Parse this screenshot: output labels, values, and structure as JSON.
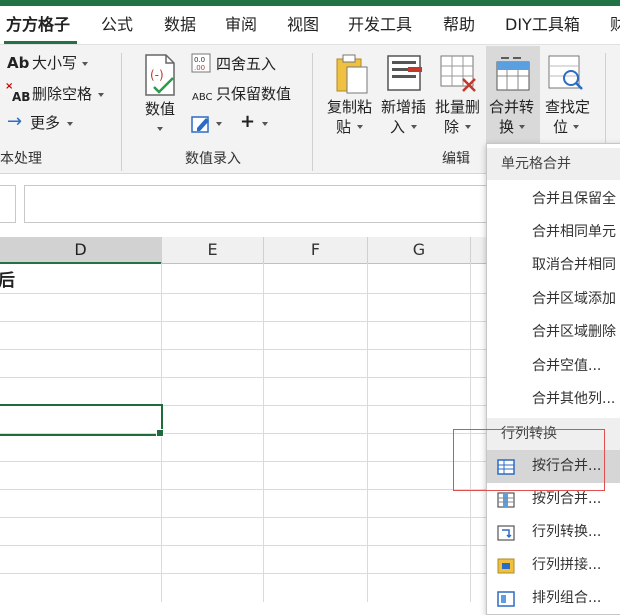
{
  "tabs": [
    "方方格子",
    "公式",
    "数据",
    "审阅",
    "视图",
    "开发工具",
    "帮助",
    "DIY工具箱",
    "财"
  ],
  "ribbon": {
    "text_group": {
      "case_label": "大小写",
      "case_icon_text": "Ab",
      "remove_space_label": "删除空格",
      "remove_space_icon_text": "AB",
      "more_label": "更多",
      "group_label": "本处理"
    },
    "number_group": {
      "value_label": "数值",
      "round_label": "四舍五入",
      "keep_number_label": "只保留数值",
      "keep_number_icon_text": "ABC",
      "group_label": "数值录入"
    },
    "edit_group": {
      "copy_paste_line1": "复制粘",
      "copy_paste_line2": "贴",
      "insert_line1": "新增插",
      "insert_line2": "入",
      "batch_delete_line1": "批量删",
      "batch_delete_line2": "除",
      "merge_convert_line1": "合并转",
      "merge_convert_line2": "换",
      "find_locate_line1": "查找定",
      "find_locate_line2": "位",
      "group_label": "编辑"
    }
  },
  "sheet": {
    "columns": [
      "D",
      "E",
      "F",
      "G"
    ],
    "cell_text": "后"
  },
  "dropdown": {
    "section1_title": "单元格合并",
    "section1_items": [
      "合并且保留全",
      "合并相同单元",
      "取消合并相同",
      "合并区域添加",
      "合并区域删除",
      "合并空值...",
      "合并其他列..."
    ],
    "section2_title": "行列转换",
    "section2_items": [
      "按行合并...",
      "按列合并...",
      "行列转换...",
      "行列拼接...",
      "排列组合..."
    ]
  },
  "colors": {
    "accent": "#217346",
    "highlight_box": "#e05050",
    "hover": "#d6d6d6"
  }
}
